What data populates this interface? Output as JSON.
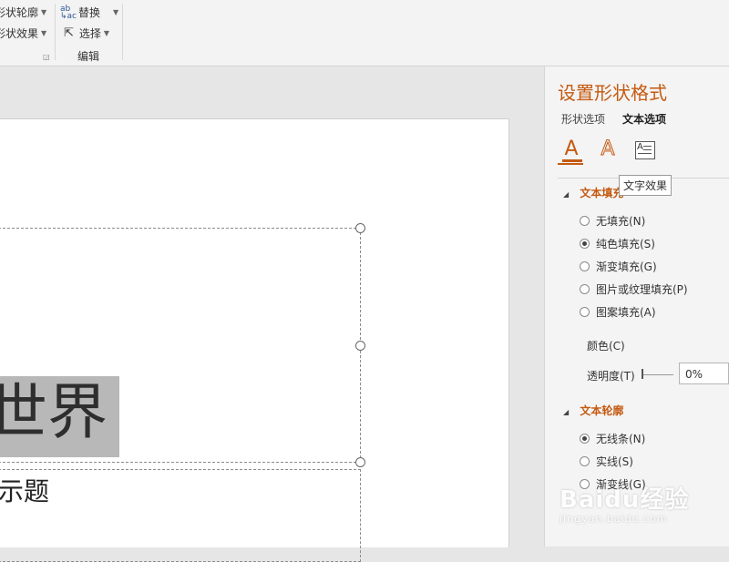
{
  "ribbon": {
    "shape_outline": "形状轮廓",
    "shape_effects": "形状效果",
    "replace": "替换",
    "select": "选择",
    "group_editing": "编辑",
    "replace_icon_text": "ab\nac"
  },
  "slide": {
    "title_text": "世界",
    "subtitle_text": "示题"
  },
  "pane": {
    "title": "设置形状格式",
    "tabs": [
      "形状选项",
      "文本选项"
    ],
    "active_tab": "文本选项",
    "icon_tabs": [
      "text-fill-outline-icon",
      "text-effects-icon",
      "textbox-icon"
    ],
    "tooltip": "文字效果",
    "text_fill": {
      "header": "文本填充",
      "options": [
        "无填充(N)",
        "纯色填充(S)",
        "渐变填充(G)",
        "图片或纹理填充(P)",
        "图案填充(A)"
      ],
      "selected": "纯色填充(S)",
      "color_label": "颜色(C)",
      "transparency_label": "透明度(T)",
      "transparency_value": "0%"
    },
    "text_outline": {
      "header": "文本轮廓",
      "options": [
        "无线条(N)",
        "实线(S)",
        "渐变线(G)"
      ],
      "selected": "无线条(N)"
    }
  },
  "watermark": {
    "main": "Baidu经验",
    "sub": "jingyan.baidu.com"
  },
  "colors": {
    "accent": "#c55a11",
    "ribbon_bg": "#f3f3f3",
    "pane_bg": "#f4f4f4",
    "selection": "#b8b8b8"
  }
}
